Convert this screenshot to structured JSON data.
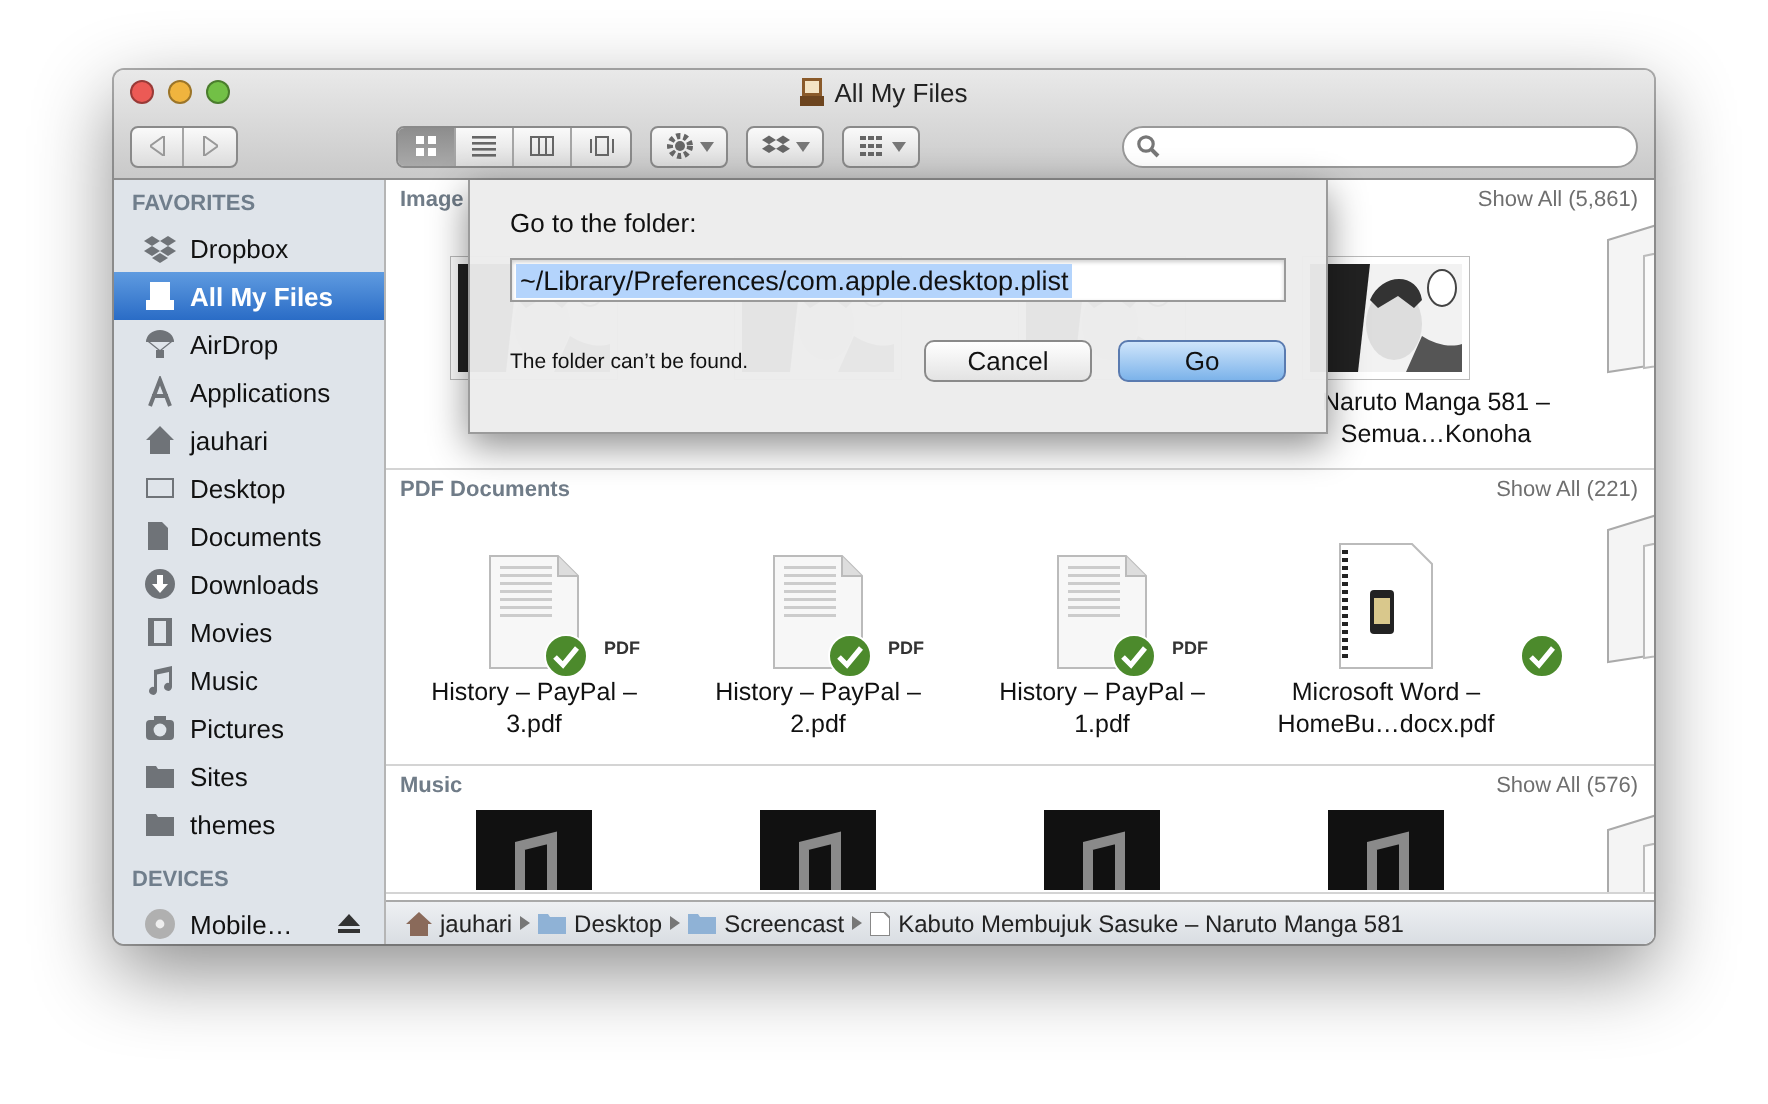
{
  "window": {
    "title": "All My Files"
  },
  "toolbar": {
    "view_buttons": [
      {
        "kind": "icons",
        "selected": true
      },
      {
        "kind": "list",
        "selected": false
      },
      {
        "kind": "columns",
        "selected": false
      },
      {
        "kind": "coverflow",
        "selected": false
      }
    ]
  },
  "sidebar": [
    {
      "heading": "FAVORITES",
      "items": [
        {
          "label": "Dropbox",
          "kind": "dropbox",
          "selected": false
        },
        {
          "label": "All My Files",
          "kind": "files",
          "selected": true
        },
        {
          "label": "AirDrop",
          "kind": "airdrop",
          "selected": false
        },
        {
          "label": "Applications",
          "kind": "apps",
          "selected": false
        },
        {
          "label": "jauhari",
          "kind": "home",
          "selected": false
        },
        {
          "label": "Desktop",
          "kind": "desktop",
          "selected": false
        },
        {
          "label": "Documents",
          "kind": "documents",
          "selected": false
        },
        {
          "label": "Downloads",
          "kind": "downloads",
          "selected": false
        },
        {
          "label": "Movies",
          "kind": "movies",
          "selected": false
        },
        {
          "label": "Music",
          "kind": "music",
          "selected": false
        },
        {
          "label": "Pictures",
          "kind": "pictures",
          "selected": false
        },
        {
          "label": "Sites",
          "kind": "folder",
          "selected": false
        },
        {
          "label": "themes",
          "kind": "folder",
          "selected": false
        }
      ]
    },
    {
      "heading": "DEVICES",
      "items": [
        {
          "label": "Mobile…",
          "kind": "disc",
          "selected": false
        }
      ]
    }
  ],
  "sections": [
    {
      "title": "Image",
      "show_all": "Show All (5,861)",
      "items": [
        {
          "kind": "picture"
        },
        {
          "kind": "picture"
        },
        {
          "kind": "picture"
        },
        {
          "kind": "picture",
          "label": "Naruto Manga 581 – Semua…Konoha"
        },
        {
          "kind": "stack"
        }
      ]
    },
    {
      "title": "PDF Documents",
      "show_all": "Show All (221)",
      "items": [
        {
          "kind": "pdf",
          "synced": true,
          "badge": "PDF",
          "label": "History – PayPal – 3.pdf"
        },
        {
          "kind": "pdf",
          "synced": true,
          "badge": "PDF",
          "label": "History – PayPal – 2.pdf"
        },
        {
          "kind": "pdf",
          "synced": true,
          "badge": "PDF",
          "label": "History – PayPal – 1.pdf"
        },
        {
          "kind": "doc",
          "synced": false,
          "label": "Microsoft Word – HomeBu…docx.pdf"
        },
        {
          "kind": "stack",
          "synced": true
        }
      ]
    },
    {
      "title": "Music",
      "show_all": "Show All (576)",
      "items": [
        {
          "kind": "music"
        },
        {
          "kind": "music"
        },
        {
          "kind": "music"
        },
        {
          "kind": "music"
        },
        {
          "kind": "stack"
        }
      ]
    }
  ],
  "path_bar": [
    {
      "label": "jauhari",
      "kind": "home"
    },
    {
      "label": "Desktop",
      "kind": "folder"
    },
    {
      "label": "Screencast",
      "kind": "folder"
    },
    {
      "label": "Kabuto Membujuk Sasuke – Naruto Manga 581",
      "kind": "file"
    }
  ],
  "dialog": {
    "prompt": "Go to the folder:",
    "value": "~/Library/Preferences/com.apple.desktop.plist",
    "message": "The folder can’t be found.",
    "buttons": [
      {
        "label": "Cancel",
        "default": false
      },
      {
        "label": "Go",
        "default": true
      }
    ]
  }
}
